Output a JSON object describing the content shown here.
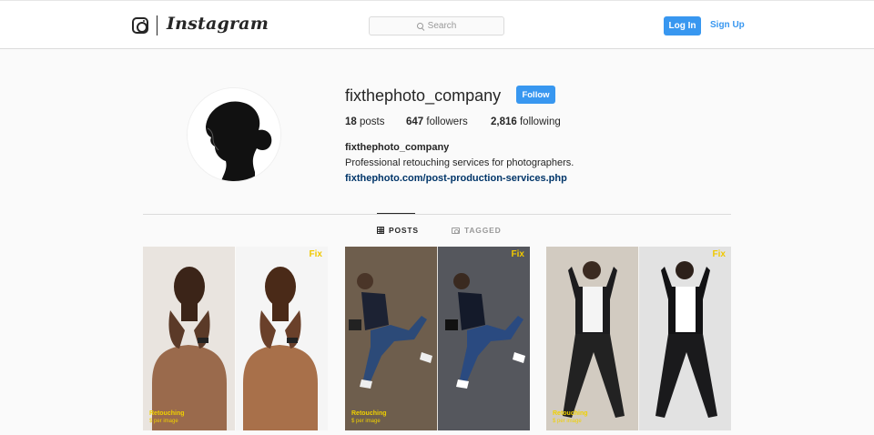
{
  "header": {
    "brand": "Instagram",
    "search_placeholder": "Search",
    "login_label": "Log In",
    "signup_label": "Sign Up"
  },
  "profile": {
    "username": "fixthephoto_company",
    "follow_label": "Follow",
    "posts_count": "18",
    "posts_label": "posts",
    "followers_count": "647",
    "followers_label": "followers",
    "following_count": "2,816",
    "following_label": "following",
    "full_name": "fixthephoto_company",
    "bio": "Professional retouching services for photographers.",
    "link": "fixthephoto.com/post-production-services.php"
  },
  "tabs": [
    {
      "label": "POSTS",
      "icon": "grid-icon",
      "active": true
    },
    {
      "label": "TAGGED",
      "icon": "tag-icon",
      "active": false
    }
  ],
  "posts": [
    {
      "watermark": "Fix",
      "caption": "Retouching",
      "subcaption": "$ per image",
      "subject": "shirtless man with hands on neck, before/after"
    },
    {
      "watermark": "Fix",
      "caption": "Retouching",
      "subcaption": "$ per image",
      "subject": "man in jacket posing with camera, before/after"
    },
    {
      "watermark": "Fix",
      "caption": "Retouching",
      "subcaption": "$ per image",
      "subject": "man in suit posing, before/after"
    }
  ],
  "colors": {
    "accent": "#3897f0",
    "link": "#003569",
    "text": "#262626",
    "muted": "#999999",
    "background": "#fafafa"
  }
}
